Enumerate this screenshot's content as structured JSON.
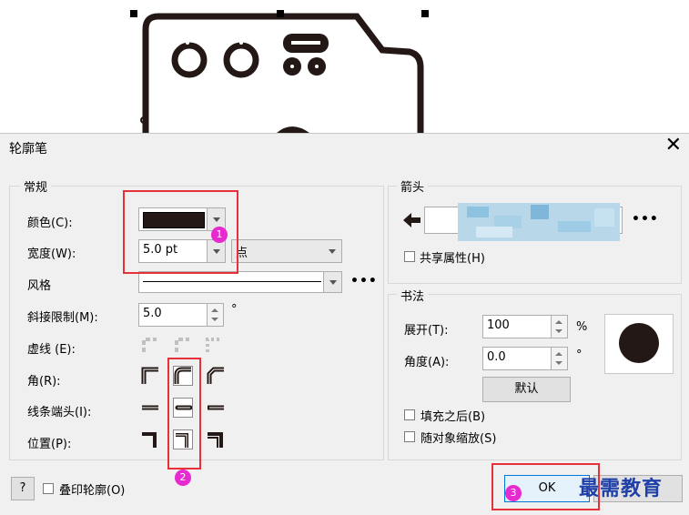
{
  "dialog": {
    "title": "轮廓笔",
    "close_icon": "close-icon"
  },
  "general": {
    "group_label": "常规",
    "color_label": "颜色(C):",
    "color_value": "#231815",
    "width_label": "宽度(W):",
    "width_value": "5.0 pt",
    "unit_value": "点",
    "style_label": "风格",
    "miter_label": "斜接限制(M):",
    "miter_value": "5.0",
    "miter_unit": "°",
    "dash_label": "虚线 (E):",
    "corner_label": "角(R):",
    "linecap_label": "线条端头(I):",
    "position_label": "位置(P):"
  },
  "arrows": {
    "group_label": "箭头",
    "share_label": "共享属性(H)"
  },
  "calligraphy": {
    "group_label": "书法",
    "stretch_label": "展开(T):",
    "stretch_value": "100",
    "stretch_unit": "%",
    "angle_label": "角度(A):",
    "angle_value": "0.0",
    "angle_unit": "°",
    "default_button": "默认",
    "fill_behind_label": "填充之后(B)",
    "scale_label": "随对象缩放(S)"
  },
  "footer": {
    "help_button": "?",
    "overprint_label": "叠印轮廓(O)",
    "ok_button": "OK"
  },
  "annotations": {
    "badge_1": "1",
    "badge_2": "2",
    "badge_3": "3"
  },
  "watermark": "最需教育",
  "colors": {
    "annotation_red": "#e8303b",
    "badge_magenta": "#e62ad0",
    "swatch": "#231815",
    "watermark_blue": "#1f3fa8"
  }
}
